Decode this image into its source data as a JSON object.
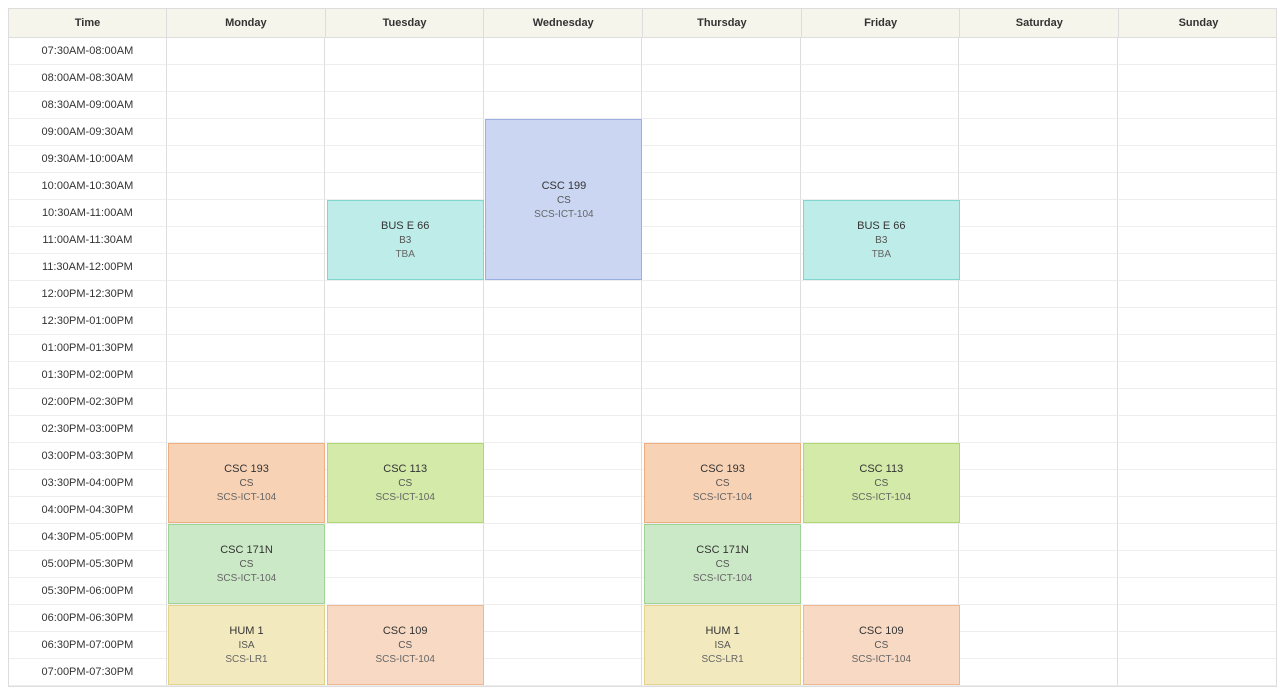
{
  "headers": [
    "Time",
    "Monday",
    "Tuesday",
    "Wednesday",
    "Thursday",
    "Friday",
    "Saturday",
    "Sunday"
  ],
  "timeSlots": [
    "07:30AM-08:00AM",
    "08:00AM-08:30AM",
    "08:30AM-09:00AM",
    "09:00AM-09:30AM",
    "09:30AM-10:00AM",
    "10:00AM-10:30AM",
    "10:30AM-11:00AM",
    "11:00AM-11:30AM",
    "11:30AM-12:00PM",
    "12:00PM-12:30PM",
    "12:30PM-01:00PM",
    "01:00PM-01:30PM",
    "01:30PM-02:00PM",
    "02:00PM-02:30PM",
    "02:30PM-03:00PM",
    "03:00PM-03:30PM",
    "03:30PM-04:00PM",
    "04:00PM-04:30PM",
    "04:30PM-05:00PM",
    "05:00PM-05:30PM",
    "05:30PM-06:00PM",
    "06:00PM-06:30PM",
    "06:30PM-07:00PM",
    "07:00PM-07:30PM"
  ],
  "events": [
    {
      "course": "CSC 199",
      "section": "CS",
      "room": "SCS-ICT-104",
      "day": 3,
      "startSlot": 3,
      "span": 6,
      "color": "blue"
    },
    {
      "course": "BUS E 66",
      "section": "B3",
      "room": "TBA",
      "day": 2,
      "startSlot": 6,
      "span": 3,
      "color": "cyan"
    },
    {
      "course": "BUS E 66",
      "section": "B3",
      "room": "TBA",
      "day": 5,
      "startSlot": 6,
      "span": 3,
      "color": "cyan"
    },
    {
      "course": "CSC 193",
      "section": "CS",
      "room": "SCS-ICT-104",
      "day": 1,
      "startSlot": 15,
      "span": 3,
      "color": "orange"
    },
    {
      "course": "CSC 113",
      "section": "CS",
      "room": "SCS-ICT-104",
      "day": 2,
      "startSlot": 15,
      "span": 3,
      "color": "lime"
    },
    {
      "course": "CSC 193",
      "section": "CS",
      "room": "SCS-ICT-104",
      "day": 4,
      "startSlot": 15,
      "span": 3,
      "color": "orange"
    },
    {
      "course": "CSC 113",
      "section": "CS",
      "room": "SCS-ICT-104",
      "day": 5,
      "startSlot": 15,
      "span": 3,
      "color": "lime"
    },
    {
      "course": "CSC 171N",
      "section": "CS",
      "room": "SCS-ICT-104",
      "day": 1,
      "startSlot": 18,
      "span": 3,
      "color": "green"
    },
    {
      "course": "CSC 171N",
      "section": "CS",
      "room": "SCS-ICT-104",
      "day": 4,
      "startSlot": 18,
      "span": 3,
      "color": "green"
    },
    {
      "course": "HUM 1",
      "section": "ISA",
      "room": "SCS-LR1",
      "day": 1,
      "startSlot": 21,
      "span": 3,
      "color": "yellow"
    },
    {
      "course": "CSC 109",
      "section": "CS",
      "room": "SCS-ICT-104",
      "day": 2,
      "startSlot": 21,
      "span": 3,
      "color": "peach"
    },
    {
      "course": "HUM 1",
      "section": "ISA",
      "room": "SCS-LR1",
      "day": 4,
      "startSlot": 21,
      "span": 3,
      "color": "yellow"
    },
    {
      "course": "CSC 109",
      "section": "CS",
      "room": "SCS-ICT-104",
      "day": 5,
      "startSlot": 21,
      "span": 3,
      "color": "peach"
    }
  ]
}
